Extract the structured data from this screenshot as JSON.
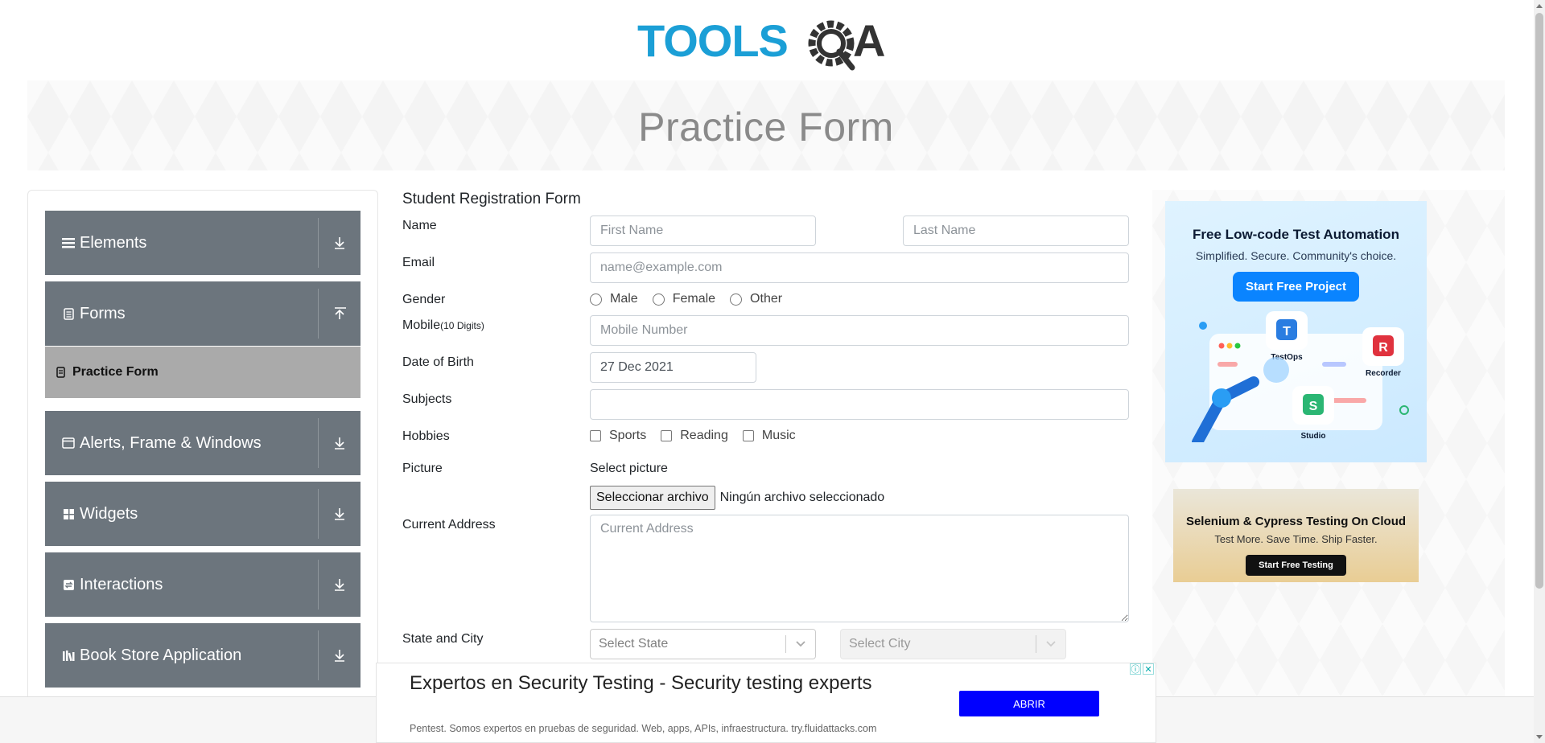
{
  "header": {
    "logo_text": "TOOLSQA"
  },
  "banner": {
    "title": "Practice Form"
  },
  "sidebar": {
    "groups": [
      {
        "label": "Elements",
        "icon": "menu-icon",
        "expanded": false
      },
      {
        "label": "Forms",
        "icon": "document-icon",
        "expanded": true
      },
      {
        "label": "Alerts, Frame & Windows",
        "icon": "window-icon",
        "expanded": false
      },
      {
        "label": "Widgets",
        "icon": "widgets-icon",
        "expanded": false
      },
      {
        "label": "Interactions",
        "icon": "interactions-icon",
        "expanded": false
      },
      {
        "label": "Book Store Application",
        "icon": "books-icon",
        "expanded": false
      }
    ],
    "forms_items": [
      {
        "label": "Practice Form",
        "active": true
      }
    ]
  },
  "form": {
    "title": "Student Registration Form",
    "name_label": "Name",
    "first_name_placeholder": "First Name",
    "last_name_placeholder": "Last Name",
    "email_label": "Email",
    "email_placeholder": "name@example.com",
    "gender_label": "Gender",
    "gender_options": [
      "Male",
      "Female",
      "Other"
    ],
    "mobile_label": "Mobile",
    "mobile_hint": "(10 Digits)",
    "mobile_placeholder": "Mobile Number",
    "dob_label": "Date of Birth",
    "dob_value": "27 Dec 2021",
    "subjects_label": "Subjects",
    "hobbies_label": "Hobbies",
    "hobbies_options": [
      "Sports",
      "Reading",
      "Music"
    ],
    "picture_label": "Picture",
    "picture_prompt": "Select picture",
    "file_button": "Seleccionar archivo",
    "file_status": "Ningún archivo seleccionado",
    "address_label": "Current Address",
    "address_placeholder": "Current Address",
    "state_city_label": "State and City",
    "state_placeholder": "Select State",
    "city_placeholder": "Select City"
  },
  "ads": {
    "ad1": {
      "title": "Free Low-code Test Automation",
      "subtitle": "Simplified. Secure. Community's choice.",
      "cta": "Start Free Project",
      "labels": [
        "TestOps",
        "Recorder",
        "Studio"
      ]
    },
    "ad2": {
      "title": "Selenium & Cypress Testing On Cloud",
      "subtitle": "Test More. Save Time. Ship Faster.",
      "cta": "Start Free Testing"
    },
    "bottom": {
      "headline": "Expertos en Security Testing - Security testing experts",
      "sub": "Pentest. Somos expertos en pruebas de seguridad. Web, apps, APIs, infraestructura. try.fluidattacks.com",
      "cta": "ABRIR"
    }
  },
  "colors": {
    "sidebar_group": "#6c757d",
    "sidebar_active": "#aaaaaa",
    "logo_blue": "#1b9fd6",
    "logo_dark": "#333333",
    "ad_button_blue": "#0000ff"
  }
}
